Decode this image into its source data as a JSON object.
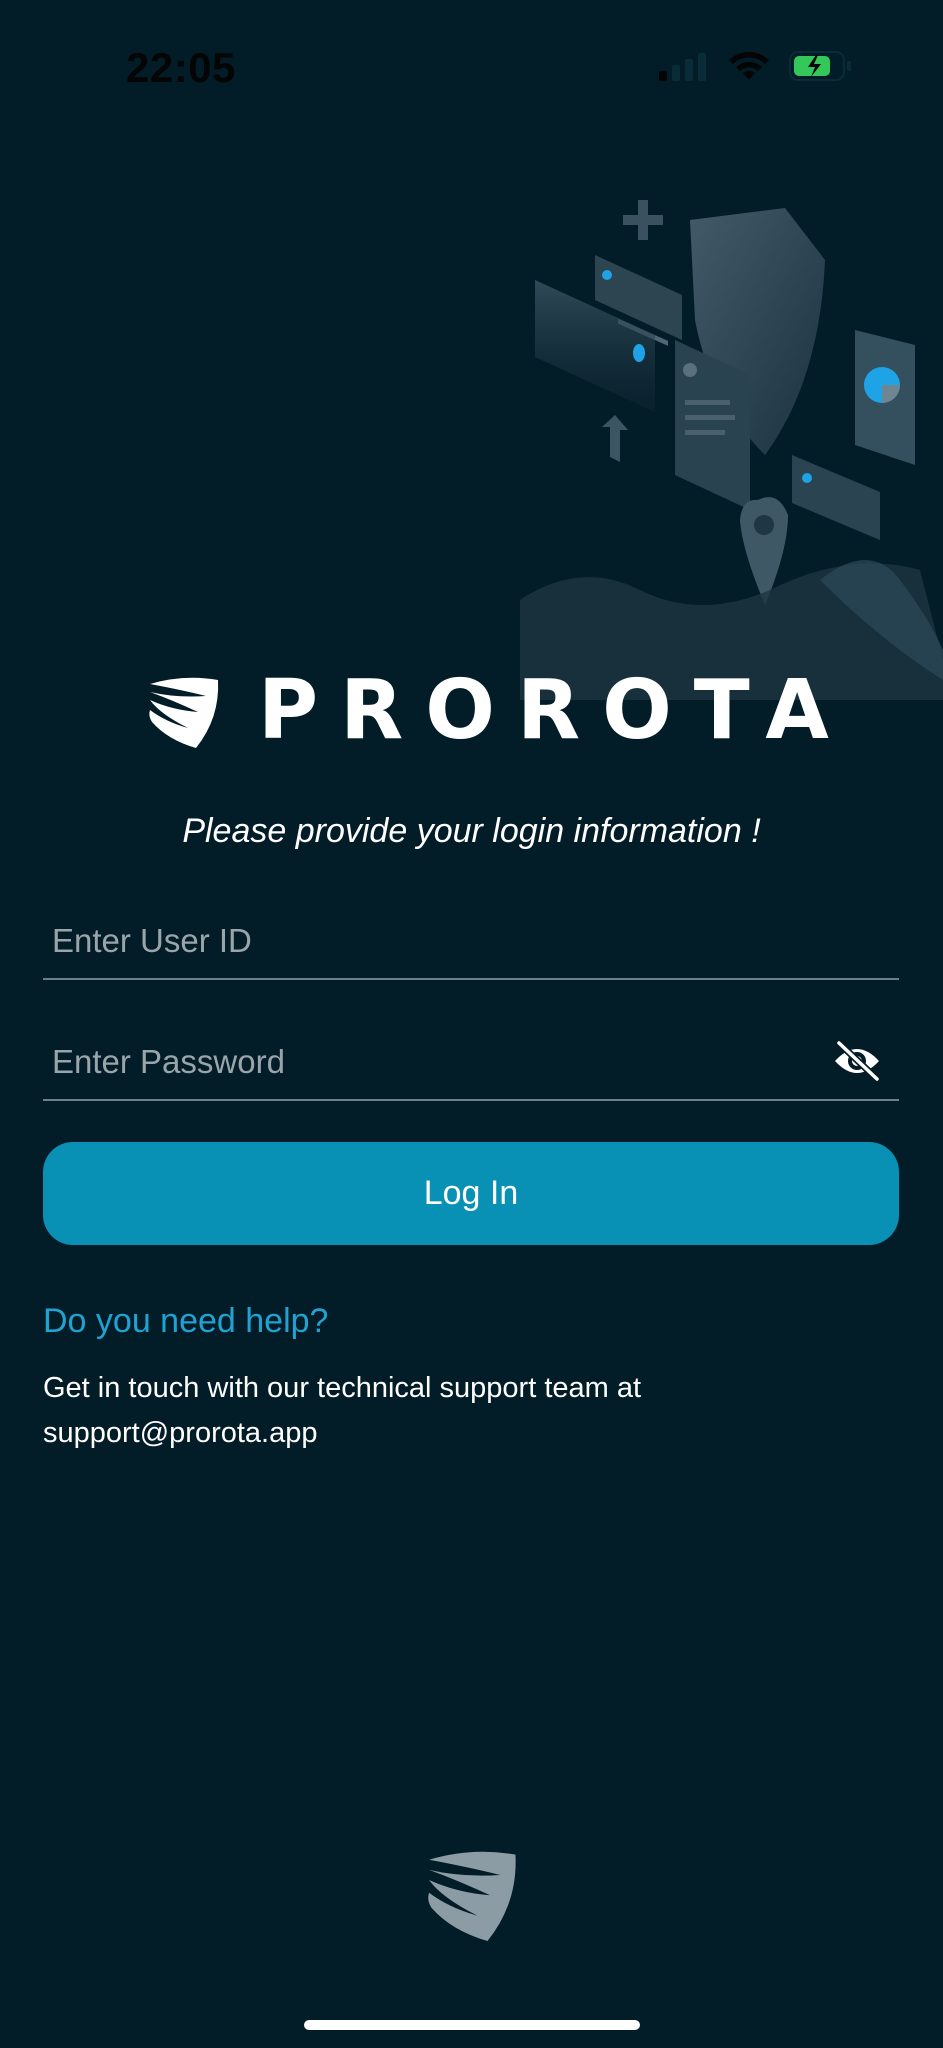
{
  "status_bar": {
    "time": "22:05",
    "icons": [
      "signal-icon",
      "wifi-icon",
      "battery-charging-icon"
    ]
  },
  "brand": {
    "name": "PROROTA",
    "logo_icon": "shield-logo-icon"
  },
  "login": {
    "prompt": "Please provide your login information !",
    "user_id_placeholder": "Enter User ID",
    "user_id_value": "",
    "password_placeholder": "Enter Password",
    "password_value": "",
    "visibility_icon": "eye-slash-icon",
    "button_label": "Log In"
  },
  "help": {
    "link_text": "Do you need help?",
    "support_text": "Get in touch with our technical support team at support@prorota.app"
  },
  "colors": {
    "background": "#021c28",
    "accent": "#0891b5",
    "link": "#1ea3d2",
    "battery": "#34c759"
  }
}
